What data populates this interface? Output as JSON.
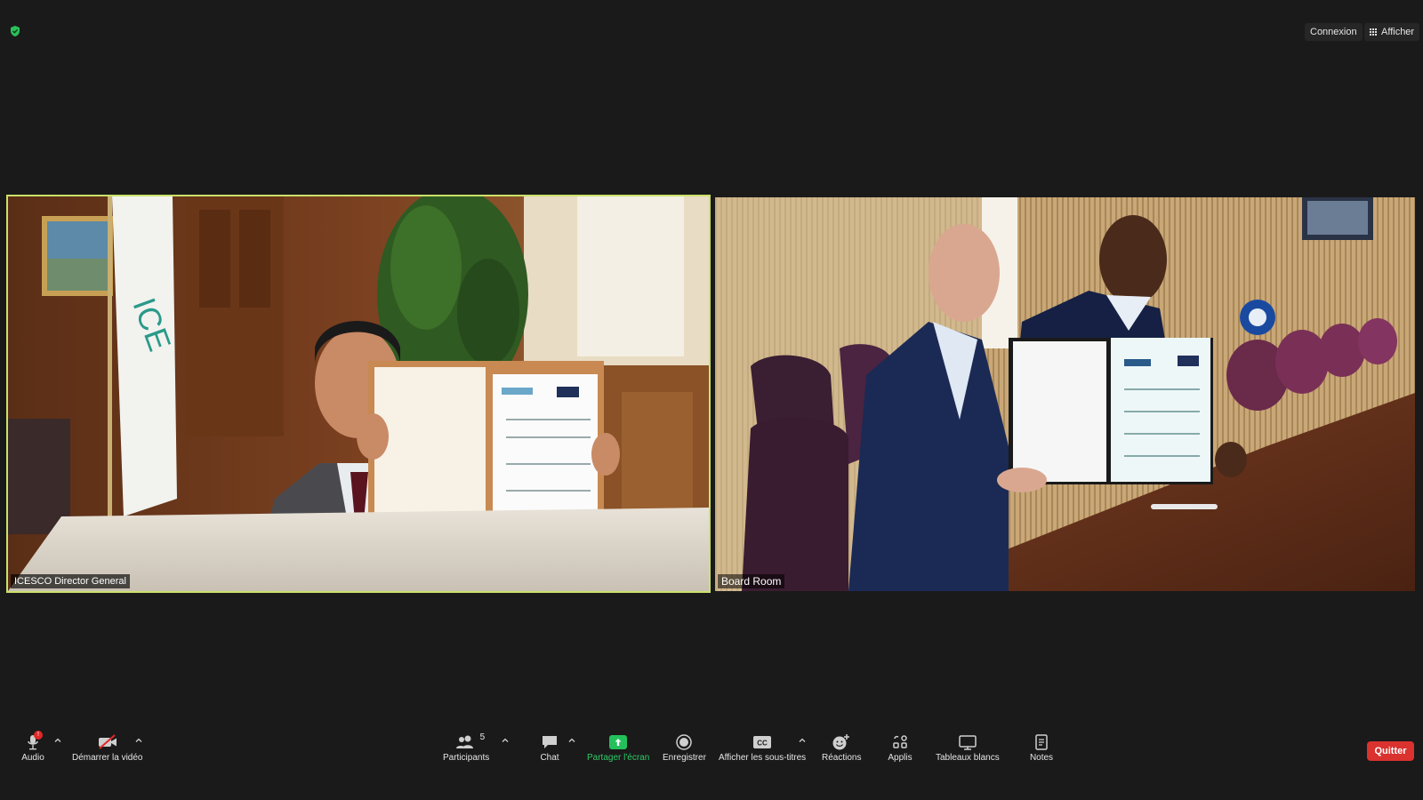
{
  "top": {
    "connexion_label": "Connexion",
    "afficher_label": "Afficher"
  },
  "tiles": {
    "left": {
      "name": "ICESCO Director General",
      "flag_text": "ICE"
    },
    "right": {
      "name": "Board Room"
    }
  },
  "toolbar": {
    "audio_label": "Audio",
    "audio_badge": "!",
    "video_label": "Démarrer la vidéo",
    "participants_label": "Participants",
    "participants_count": "5",
    "chat_label": "Chat",
    "share_label": "Partager l'écran",
    "record_label": "Enregistrer",
    "captions_label": "Afficher les sous-titres",
    "captions_icon_text": "CC",
    "reactions_label": "Réactions",
    "apps_label": "Applis",
    "whiteboards_label": "Tableaux blancs",
    "notes_label": "Notes",
    "quit_label": "Quitter"
  },
  "colors": {
    "background": "#1a1a1a",
    "active_speaker_border": "#cbe16a",
    "share_green": "#24c05b",
    "quit_red": "#d9322f",
    "shield_green": "#2bbf5a"
  }
}
